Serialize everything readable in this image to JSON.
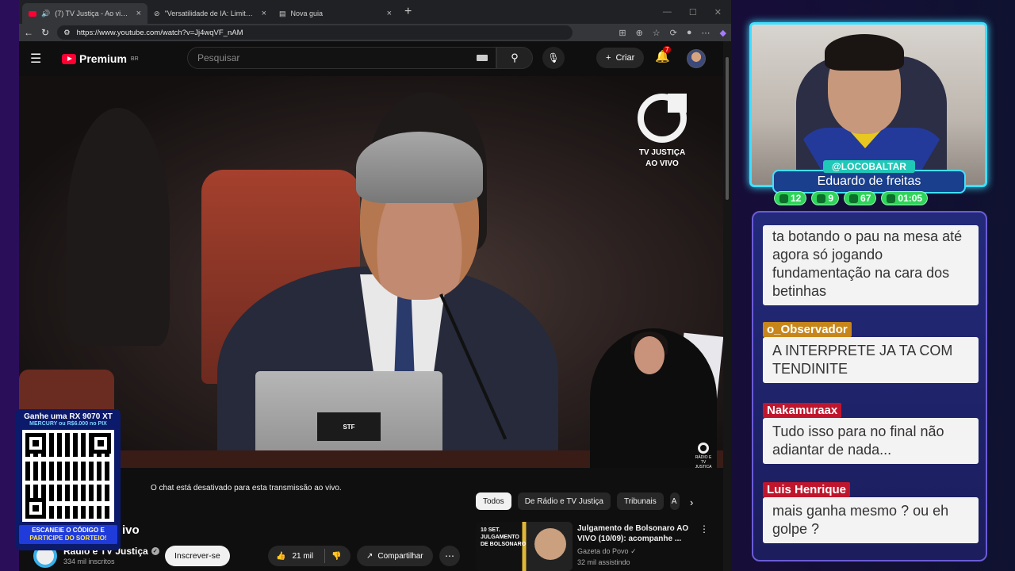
{
  "browser": {
    "tabs": [
      {
        "label": "(7) TV Justiça - Ao vivo - YouTube",
        "active": true
      },
      {
        "label": "\"Versatilidade de IA: Limitações e",
        "active": false
      },
      {
        "label": "Nova guia",
        "active": false
      }
    ],
    "url": "https://www.youtube.com/watch?v=Jj4wqVF_nAM"
  },
  "youtube": {
    "logo": "Premium",
    "region": "BR",
    "search_placeholder": "Pesquisar",
    "create_label": "Criar",
    "notification_count": "7"
  },
  "video": {
    "watermark_line1": "TV JUSTIÇA",
    "watermark_line2": "AO VIVO",
    "laptop_label": "STF",
    "corner_logo": "RÁDIO E TV JUSTIÇA"
  },
  "below": {
    "chat_disabled": "O chat está desativado para esta transmissão ao vivo.",
    "title_fragment": "ivo",
    "channel": "Rádio e TV Justiça",
    "subscribers": "334 mil inscritos",
    "subscribe_label": "Inscrever-se",
    "likes": "21 mil",
    "share_label": "Compartilhar",
    "chips": [
      "Todos",
      "De Rádio e TV Justiça",
      "Tribunais",
      "A"
    ],
    "recommended": {
      "title": "Julgamento de Bolsonaro AO VIVO (10/09): acompanhe ...",
      "channel": "Gazeta do Povo",
      "views": "32 mil assistindo",
      "thumb_text": "10 SET. JULGAMENTO DE BOLSONARO"
    }
  },
  "qr_overlay": {
    "headline": "Ganhe uma RX 9070 XT",
    "subline": "MERCURY ou R$6.000 no PIX",
    "footer1": "ESCANEIE O CÓDIGO E",
    "footer2": "PARTICIPE DO SORTEIO!"
  },
  "streamer": {
    "handle": "@LOCOBALTAR",
    "name": "Eduardo de freitas",
    "stats": [
      {
        "icon": "twitch-icon",
        "value": "12"
      },
      {
        "icon": "youtube-icon",
        "value": "9"
      },
      {
        "icon": "kick-icon",
        "value": "67"
      },
      {
        "icon": "clock-icon",
        "value": "01:05"
      }
    ]
  },
  "chat": [
    {
      "user": "",
      "text": "ta botando o pau na mesa até agora só jogando fundamentação na cara dos betinhas"
    },
    {
      "user": "o_Observador",
      "text": "A INTERPRETE JA TA COM TENDINITE",
      "gold": true
    },
    {
      "user": "Nakamuraax",
      "text": "Tudo isso para no final não adiantar de nada..."
    },
    {
      "user": "Luis Henrique",
      "text": "mais ganha mesmo ? ou eh golpe ?"
    }
  ]
}
